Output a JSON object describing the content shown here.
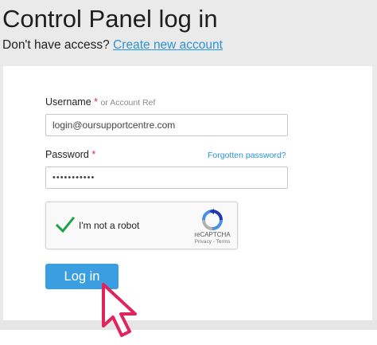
{
  "header": {
    "title": "Control Panel log in",
    "access_prompt": "Don't have access?",
    "create_account_link": "Create new account"
  },
  "form": {
    "username": {
      "label": "Username",
      "required_mark": "*",
      "hint": "or Account Ref",
      "value": "login@oursupportcentre.com"
    },
    "password": {
      "label": "Password",
      "required_mark": "*",
      "value": "•••••••••••",
      "forgot_link": "Forgotten password?"
    },
    "captcha": {
      "label": "I'm not a robot",
      "checked": true,
      "brand": "reCAPTCHA",
      "terms": "Privacy - Terms"
    },
    "submit_label": "Log in"
  },
  "colors": {
    "accent": "#3a9ee0",
    "link": "#2a93d5",
    "required": "#e0245e",
    "check": "#1fa14a",
    "cursor": "#e0245e"
  },
  "icons": [
    "checkmark-icon",
    "recaptcha-logo-icon",
    "mouse-pointer-icon"
  ]
}
